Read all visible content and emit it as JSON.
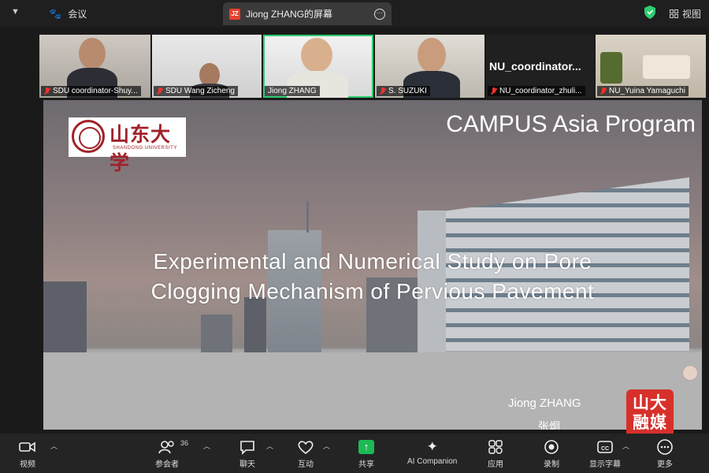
{
  "topbar": {
    "meeting_label": "会议",
    "share_tab_badge": "JZ",
    "share_tab_title": "Jiong ZHANG的屏幕",
    "view_label": "视图",
    "shield_color": "#2ecc71"
  },
  "participants": [
    {
      "name": "SDU coordinator-Shuy...",
      "muted": true
    },
    {
      "name": "SDU Wang Zicheng",
      "muted": true
    },
    {
      "name": "Jiong ZHANG",
      "muted": false,
      "active_speaker": true
    },
    {
      "name": "S. SUZUKI",
      "muted": true
    },
    {
      "name": "NU_coordinator_zhuli...",
      "muted": true,
      "display_name": "NU_coordinator..."
    },
    {
      "name": "NU_Yuina Yamaguchi",
      "muted": true
    }
  ],
  "slide": {
    "logo_cn": "山东大学",
    "logo_en": "SHANDONG UNIVERSITY",
    "header": "CAMPUS Asia Program",
    "title_line1": "Experimental and Numerical Study on Pore",
    "title_line2": "Clogging Mechanism of Pervious Pavement",
    "presenter": "Jiong ZHANG",
    "presenter_cn": "张炯"
  },
  "watermark": {
    "line1": "山大",
    "line2": "融媒",
    "color": "#d7302b"
  },
  "toolbar": {
    "video": "视频",
    "participants": "参会者",
    "participants_count": "36",
    "chat": "聊天",
    "reactions": "互动",
    "share": "共享",
    "ai_companion": "AI Companion",
    "apps": "应用",
    "record": "录制",
    "captions": "显示字幕",
    "more": "更多"
  }
}
